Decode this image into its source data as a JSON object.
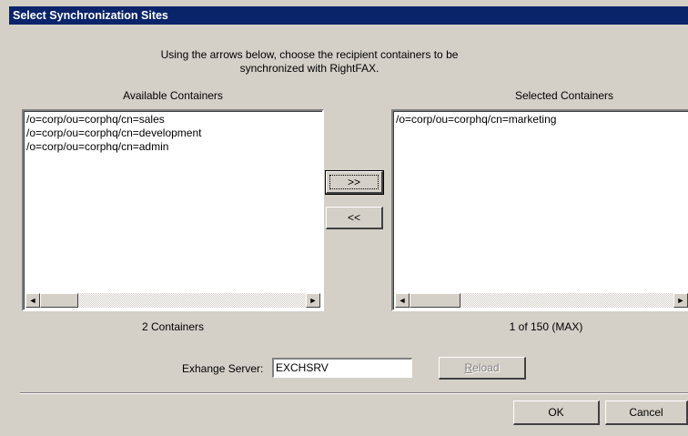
{
  "dialog": {
    "title": "Select Synchronization Sites",
    "instructions": "Using the arrows below, choose the recipient containers to be synchronized with RightFAX."
  },
  "available": {
    "label": "Available Containers",
    "items": [
      "/o=corp/ou=corphq/cn=sales",
      "/o=corp/ou=corphq/cn=development",
      "/o=corp/ou=corphq/cn=admin"
    ],
    "count": "2 Containers"
  },
  "selected": {
    "label": "Selected Containers",
    "items": [
      "/o=corp/ou=corphq/cn=marketing"
    ],
    "count": "1 of 150 (MAX)"
  },
  "buttons": {
    "add": ">>",
    "remove": "<<",
    "reload": "Reload",
    "ok": "OK",
    "cancel": "Cancel"
  },
  "server": {
    "label": "Exhange Server:",
    "value": "EXCHSRV"
  },
  "scroll": {
    "left_arrow": "◄",
    "right_arrow": "►"
  }
}
